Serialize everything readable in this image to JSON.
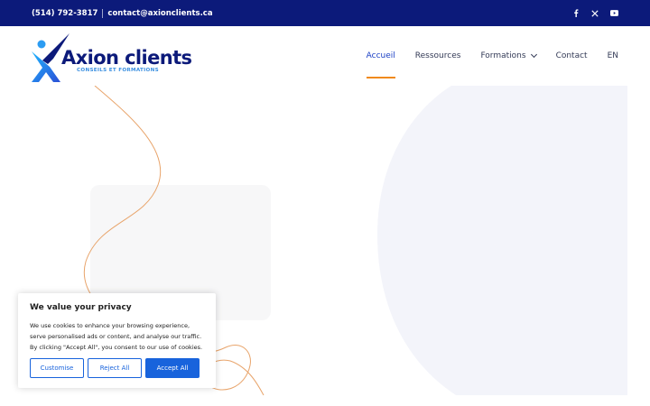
{
  "topbar": {
    "phone": "(514) 792-3817",
    "email": "contact@axionclients.ca",
    "social": [
      {
        "icon": "facebook-icon",
        "glyph": "f"
      },
      {
        "icon": "x-twitter-icon",
        "glyph": "𝕏"
      },
      {
        "icon": "youtube-icon",
        "glyph": "▶"
      }
    ]
  },
  "header": {
    "logo_text": "Axion clients",
    "logo_tagline": "CONSEILS ET FORMATIONS",
    "nav": [
      {
        "label": "Accueil",
        "active": true
      },
      {
        "label": "Ressources"
      },
      {
        "label": "Formations",
        "has_dropdown": true
      },
      {
        "label": "Contact"
      },
      {
        "label": "EN"
      }
    ]
  },
  "cookie": {
    "title": "We value your privacy",
    "body": "We use cookies to enhance your browsing experience, serve personalised ads or content, and analyse our traffic. By clicking \"Accept All\", you consent to our use of cookies.",
    "customise_label": "Customise",
    "reject_label": "Reject All",
    "accept_label": "Accept All"
  },
  "colors": {
    "topbar_bg": "#0c1a7a",
    "accent_blue": "#1863dc",
    "nav_active": "#1a3fc4",
    "nav_underline": "#f08a1c",
    "hero_shape": "#f3f4fa"
  }
}
